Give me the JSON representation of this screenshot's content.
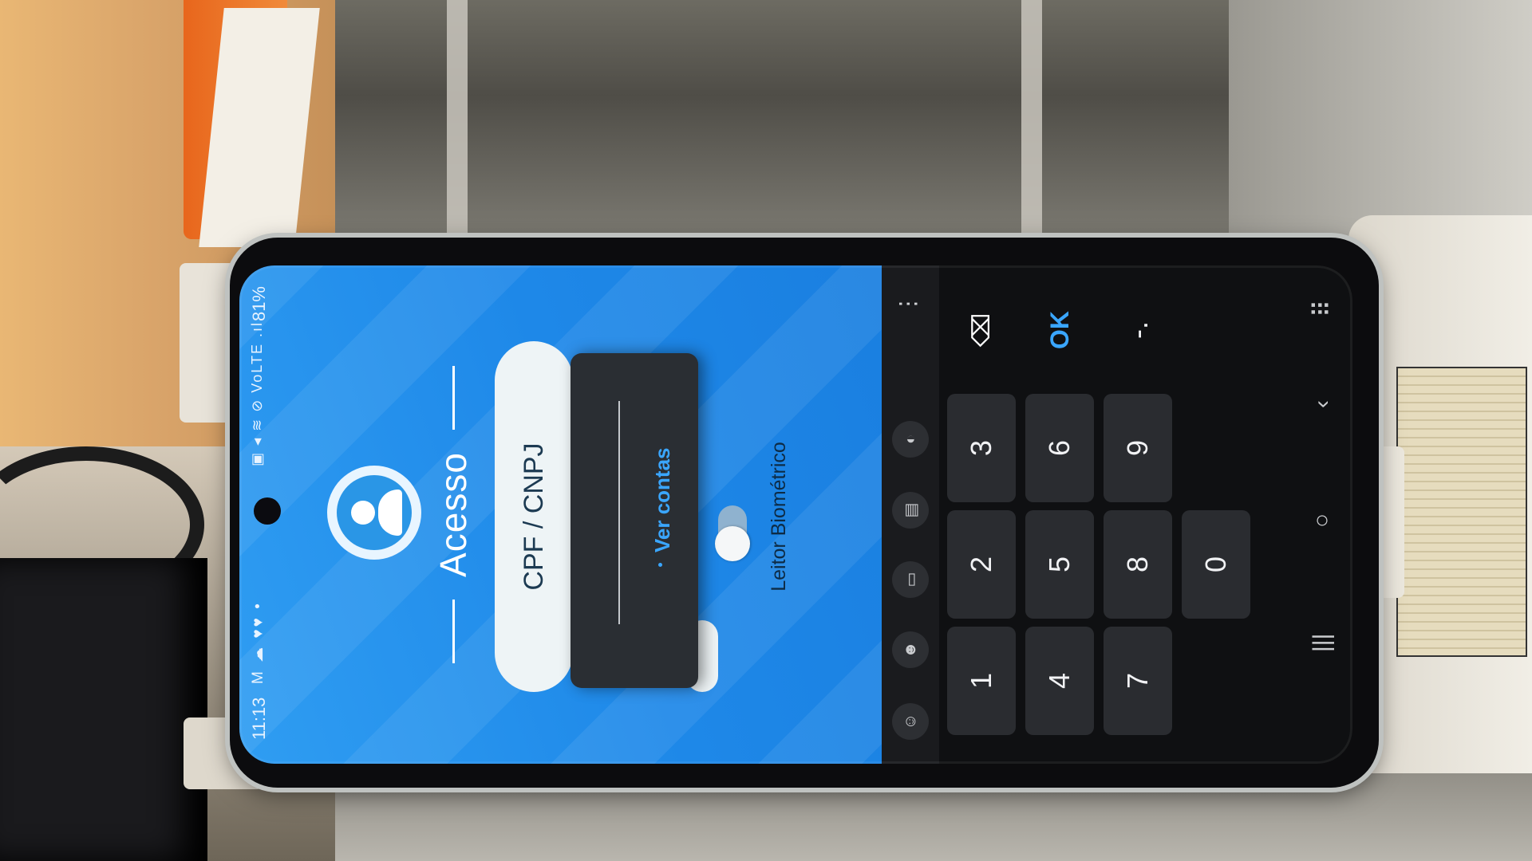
{
  "status_bar": {
    "time": "11:13",
    "left_icons": "M ☁ ♥♥ •",
    "right_icons": "▣ ◂ ≋ ⊘ VoLTE .ıl",
    "battery": "81%"
  },
  "app": {
    "title": "Acesso",
    "cpf_label": "CPF / CNPJ",
    "dropdown_option": "Ver contas",
    "biometric_label": "Leitor Biométrico",
    "biometric_enabled": false,
    "brand_color": "#1e88e8"
  },
  "keyboard": {
    "toolbar_icons": [
      "emoji-icon",
      "sticker-icon",
      "gif-icon",
      "clipboard-icon",
      "mic-icon"
    ],
    "keys": [
      "1",
      "2",
      "3",
      "4",
      "5",
      "6",
      "7",
      "8",
      "9",
      "0",
      "-.",
      "OK",
      "⌫"
    ],
    "more_label": "⋮"
  },
  "nav": {
    "recent": "|||",
    "home": "○",
    "back": "‹",
    "keyboard_toggle": "⠿"
  }
}
